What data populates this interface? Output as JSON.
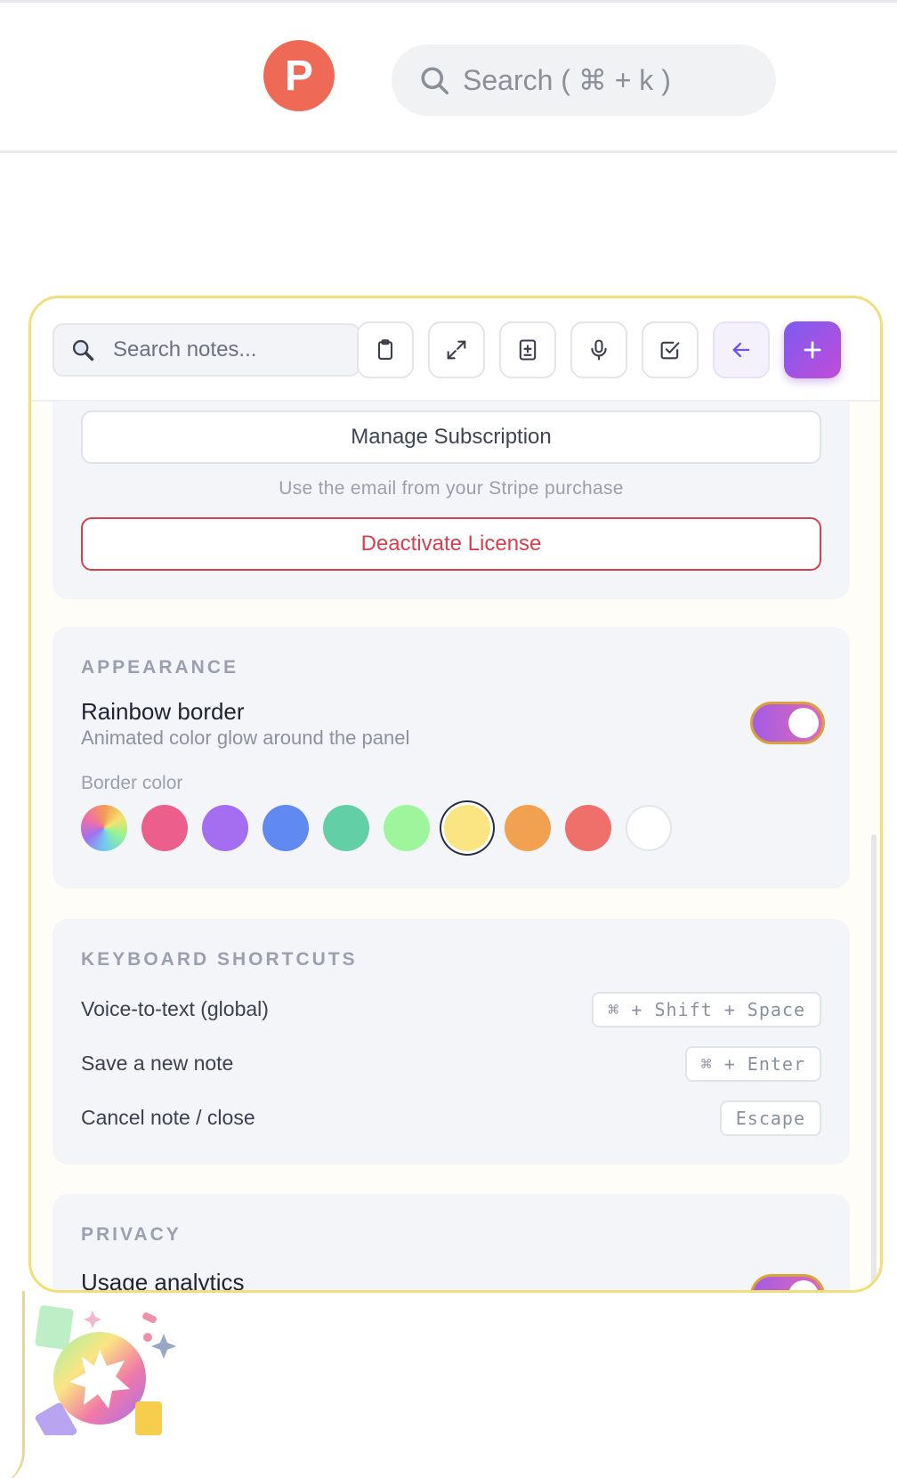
{
  "header": {
    "logo_letter": "P",
    "search_placeholder": "Search ( ⌘ + k )"
  },
  "toolbar": {
    "search_placeholder": "Search notes...",
    "buttons": [
      "clipboard-icon",
      "expand-icon",
      "add-file-icon",
      "microphone-icon",
      "checkbox-icon",
      "arrow-left-icon",
      "plus-icon"
    ]
  },
  "license": {
    "manage_label": "Manage Subscription",
    "hint": "Use the email from your Stripe purchase",
    "deactivate_label": "Deactivate License"
  },
  "appearance": {
    "title": "APPEARANCE",
    "rainbow_title": "Rainbow border",
    "rainbow_sub": "Animated color glow around the panel",
    "rainbow_enabled": true,
    "border_color_label": "Border color",
    "swatches": [
      "rainbow",
      "#ec5f8d",
      "#a56ef0",
      "#6189f2",
      "#63cfa6",
      "#9ff59c",
      "#fbe583",
      "#f2a150",
      "#ef6f6a",
      "#ffffff"
    ],
    "selected_swatch": "#fbe583"
  },
  "shortcuts": {
    "title": "KEYBOARD SHORTCUTS",
    "items": [
      {
        "label": "Voice-to-text (global)",
        "keys": "⌘ + Shift + Space"
      },
      {
        "label": "Save a new note",
        "keys": "⌘ + Enter"
      },
      {
        "label": "Cancel note / close",
        "keys": "Escape"
      }
    ]
  },
  "privacy": {
    "title": "PRIVACY",
    "usage_title": "Usage analytics",
    "usage_enabled": true
  },
  "colors": {
    "accent": "#8a5cf0",
    "danger": "#d6404e",
    "panel_border": "#f2de7a",
    "logo": "#ee6a56"
  }
}
